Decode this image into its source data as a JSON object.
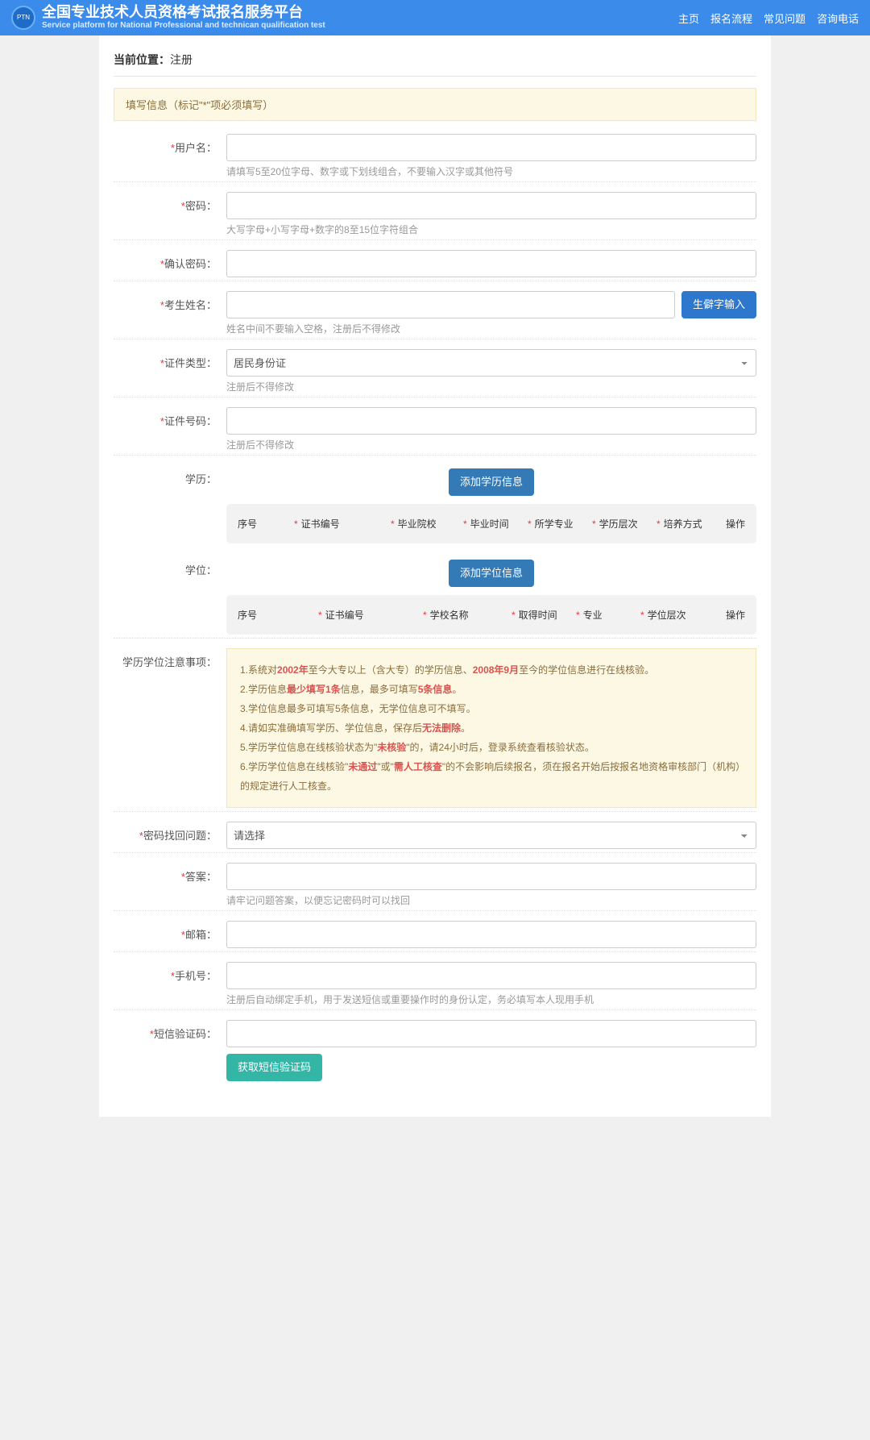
{
  "header": {
    "title_cn": "全国专业技术人员资格考试报名服务平台",
    "title_en": "Service platform for National Professional and technican qualification test",
    "nav": [
      "主页",
      "报名流程",
      "常见问题",
      "咨询电话"
    ]
  },
  "breadcrumb": {
    "label": "当前位置：",
    "page": "注册"
  },
  "panel_tip": "填写信息（标记\"*\"项必须填写）",
  "fields": {
    "username": {
      "label": "用户名：",
      "hint": "请填写5至20位字母、数字或下划线组合，不要输入汉字或其他符号"
    },
    "password": {
      "label": "密码：",
      "hint": "大写字母+小写字母+数字的8至15位字符组合"
    },
    "confirm": {
      "label": "确认密码："
    },
    "name": {
      "label": "考生姓名：",
      "hint": "姓名中间不要输入空格，注册后不得修改",
      "btn": "生僻字输入"
    },
    "id_type": {
      "label": "证件类型：",
      "hint": "注册后不得修改",
      "option": "居民身份证"
    },
    "id_no": {
      "label": "证件号码：",
      "hint": "注册后不得修改"
    },
    "edu": {
      "label": "学历：",
      "add_btn": "添加学历信息",
      "cols": [
        "序号",
        "证书编号",
        "毕业院校",
        "毕业时间",
        "所学专业",
        "学历层次",
        "培养方式",
        "操作"
      ]
    },
    "degree": {
      "label": "学位：",
      "add_btn": "添加学位信息",
      "cols": [
        "序号",
        "证书编号",
        "学校名称",
        "取得时间",
        "专业",
        "学位层次",
        "操作"
      ]
    },
    "notice": {
      "label": "学历学位注意事项：",
      "l1a": "1.系统对",
      "l1b": "2002年",
      "l1c": "至今大专以上（含大专）的学历信息、",
      "l1d": "2008年9月",
      "l1e": "至今的学位信息进行在线核验。",
      "l2a": "2.学历信息",
      "l2b": "最少填写1条",
      "l2c": "信息，最多可填写",
      "l2d": "5条信息",
      "l2e": "。",
      "l3": "3.学位信息最多可填写5条信息，无学位信息可不填写。",
      "l4a": "4.请如实准确填写学历、学位信息，保存后",
      "l4b": "无法删除",
      "l4c": "。",
      "l5a": "5.学历学位信息在线核验状态为\"",
      "l5b": "未核验",
      "l5c": "\"的，请24小时后，登录系统查看核验状态。",
      "l6a": "6.学历学位信息在线核验\"",
      "l6b": "未通过",
      "l6c": "\"或\"",
      "l6d": "需人工核查",
      "l6e": "\"的不会影响后续报名，须在报名开始后按报名地资格审核部门（机构）的规定进行人工核查。"
    },
    "secq": {
      "label": "密码找回问题：",
      "placeholder": "请选择"
    },
    "answer": {
      "label": "答案：",
      "hint": "请牢记问题答案，以便忘记密码时可以找回"
    },
    "email": {
      "label": "邮箱："
    },
    "mobile": {
      "label": "手机号：",
      "hint": "注册后自动绑定手机，用于发送短信或重要操作时的身份认定，务必填写本人现用手机"
    },
    "sms": {
      "label": "短信验证码：",
      "btn": "获取短信验证码"
    }
  }
}
